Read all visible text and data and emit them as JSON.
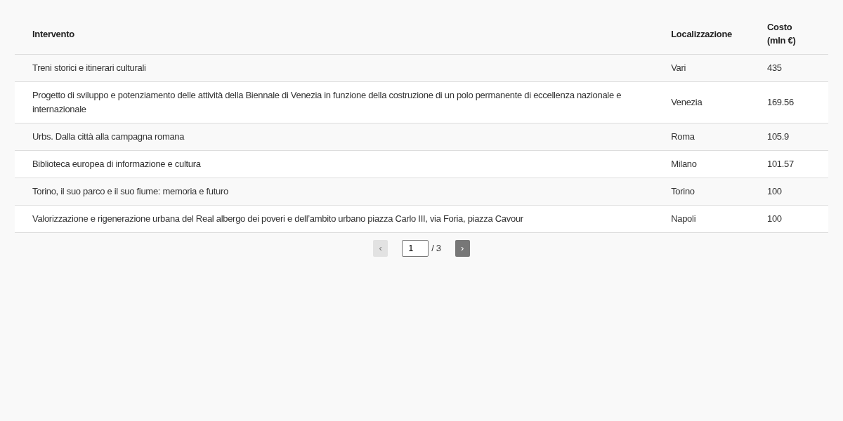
{
  "table": {
    "columns": [
      "Intervento",
      "Localizzazione",
      "Costo (mln €)"
    ],
    "rows": [
      [
        "Treni storici e itinerari culturali",
        "Vari",
        "435"
      ],
      [
        "Progetto di sviluppo e potenziamento delle attività della Biennale di Venezia in funzione della costruzione di un polo permanente di eccellenza nazionale e internazionale",
        "Venezia",
        "169.56"
      ],
      [
        "Urbs. Dalla città alla campagna romana",
        "Roma",
        "105.9"
      ],
      [
        "Biblioteca europea di informazione e cultura",
        "Milano",
        "101.57"
      ],
      [
        "Torino, il suo parco e il suo fiume: memoria e futuro",
        "Torino",
        "100"
      ],
      [
        "Valorizzazione e rigenerazione urbana del Real albergo dei poveri e dell’ambito urbano piazza Carlo III, via Foria, piazza Cavour",
        "Napoli",
        "100"
      ]
    ]
  },
  "pagination": {
    "prev": {
      "label": "‹",
      "disabled": true
    },
    "page": "1",
    "total": "/ 3",
    "next": {
      "label": "›",
      "disabled": false
    }
  }
}
